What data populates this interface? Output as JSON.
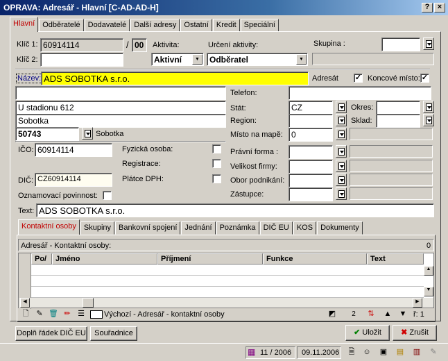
{
  "window": {
    "title": "OPRAVA: Adresář - Hlavní [C-AD-AD-H]",
    "help": "?",
    "close": "×"
  },
  "tabs": [
    "Hlavní",
    "Odběratelé",
    "Dodavatelé",
    "Další adresy",
    "Ostatní",
    "Kredit",
    "Speciální"
  ],
  "form": {
    "klic1_label": "Klíč 1:",
    "klic1": "60914114",
    "klic1_sep": "/",
    "klic1_suffix": "00",
    "klic2_label": "Klíč 2:",
    "klic2": "",
    "aktivita_label": "Aktivita:",
    "aktivita": "Aktivní",
    "urceni_label": "Určení aktivity:",
    "urceni": "Odběratel",
    "skupina_label": "Skupina :",
    "skupina": "",
    "nazev_label": "Název:",
    "nazev": "ADS SOBOTKA  s.r.o.",
    "adresat_label": "Adresát",
    "koncove_label": "Koncové místo:",
    "addr1": "",
    "ulice": "U stadionu 612",
    "mesto": "Sobotka",
    "psc": "50743",
    "psc_city": "Sobotka",
    "telefon_label": "Telefon:",
    "telefon": "",
    "stat_label": "Stát:",
    "stat": "CZ",
    "okres_label": "Okres:",
    "okres": "",
    "region_label": "Region:",
    "region": "",
    "sklad_label": "Sklad:",
    "sklad": "",
    "misto_label": "Místo na mapě:",
    "misto": "0",
    "ico_label": "IČO:",
    "ico": "60914114",
    "fyzicka_label": "Fyzická osoba:",
    "registrace_label": "Registrace:",
    "platce_label": "Plátce DPH:",
    "dic_label": "DIČ:",
    "dic": "CZ60914114",
    "oznam_label": "Oznamovací povinnost:",
    "pravni_label": "Právní forma :",
    "velikost_label": "Velikost firmy:",
    "obor_label": "Obor podnikání:",
    "zastupce_label": "Zástupce:",
    "text_label": "Text:",
    "text": "ADS SOBOTKA  s.r.o."
  },
  "subtabs": [
    "Kontaktní osoby",
    "Skupiny",
    "Bankovní spojení",
    "Jednání",
    "Poznámka",
    "DIČ EU",
    "KOS",
    "Dokumenty"
  ],
  "grid": {
    "title": "Adresář - Kontaktní osoby:",
    "count": "0",
    "columns": [
      "Po/",
      "Jméno",
      "Příjmení",
      "Funkce",
      "Text"
    ],
    "view_label": "Výchozí - Adresář - kontaktní osoby",
    "page_count": "2",
    "row_indicator": "ř: 1"
  },
  "buttons": {
    "dopln": "Doplň řádek DIČ EU",
    "souradnice": "Souřadnice",
    "ulozit": "Uložit",
    "zrusit": "Zrušit"
  },
  "status": {
    "period": "11 / 2006",
    "date": "09.11.2006"
  }
}
